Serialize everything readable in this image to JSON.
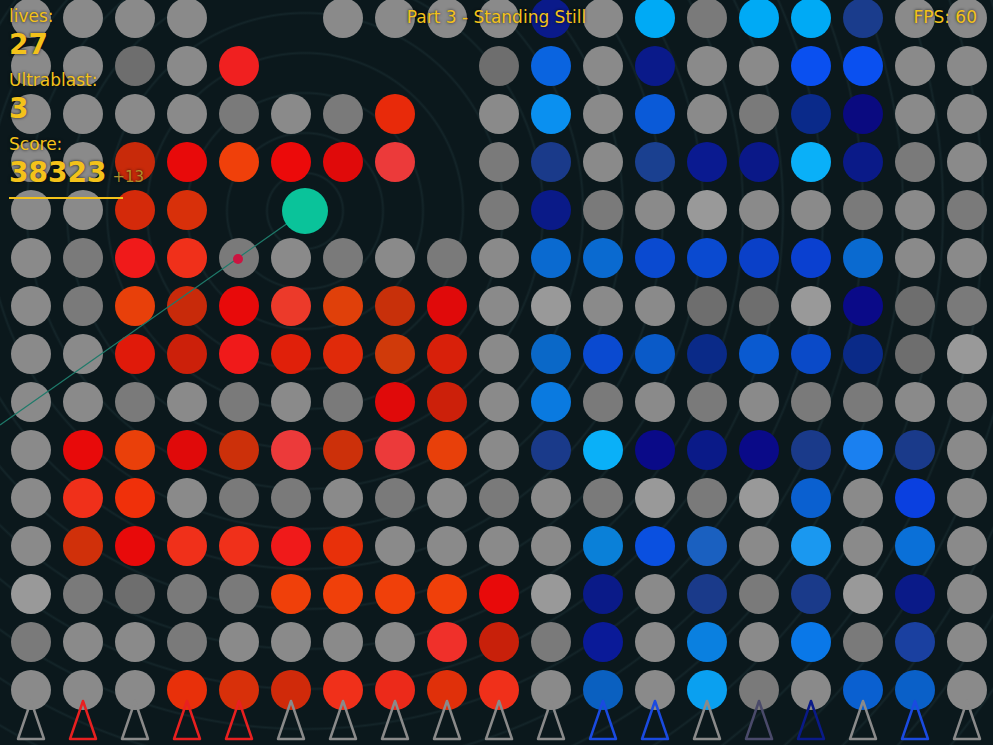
{
  "hud": {
    "lives_label": "lives:",
    "lives": "27",
    "ultrablast_label": "Ultrablast:",
    "ultrablast": "3",
    "score_label": "Score:",
    "score": "38323",
    "score_bonus": "+13"
  },
  "title": "Part 3 - Standing Still",
  "fps": "FPS: 60",
  "board": {
    "rows": [
      [
        "#8a8a8a",
        "#8a8a8a",
        "#8a8a8a",
        "#8a8a8a",
        null,
        null,
        "#8a8a8a",
        "#8a8a8a",
        "#8a8a8a",
        "#8a8a8a",
        "#0a1a8a",
        "#8a8a8a",
        "#00aaf5",
        "#7a7a7a",
        "#00aaf5",
        "#00aaf5",
        "#1a3c8c",
        "#8a8a8a",
        "#8a8a8a"
      ],
      [
        "#8a8a8a",
        "#8a8a8a",
        "#6e6e6e",
        "#8a8a8a",
        "#f02020",
        null,
        null,
        null,
        null,
        "#6e6e6e",
        "#0a64e0",
        "#8a8a8a",
        "#0a1a8a",
        "#8a8a8a",
        "#8a8a8a",
        "#0a50f0",
        "#0a50f0",
        "#8a8a8a",
        "#8a8a8a"
      ],
      [
        "#8a8a8a",
        "#8a8a8a",
        "#8a8a8a",
        "#8a8a8a",
        "#7a7a7a",
        "#8a8a8a",
        "#7a7a7a",
        "#e82a0a",
        null,
        "#8a8a8a",
        "#0a90f0",
        "#8a8a8a",
        "#0a5ad8",
        "#8a8a8a",
        "#7a7a7a",
        "#0a2a8a",
        "#0a0a80",
        "#8a8a8a",
        "#8a8a8a"
      ],
      [
        "#8a8a8a",
        "#8a8a8a",
        "#c82a0a",
        "#e80a0a",
        "#f0400a",
        "#ec0a0a",
        "#e00a0a",
        "#ec3a3a",
        null,
        "#7a7a7a",
        "#1a3a8a",
        "#8a8a8a",
        "#1a4090",
        "#0a1a90",
        "#0a1888",
        "#0ab0f8",
        "#0a1a88",
        "#7a7a7a",
        "#8a8a8a"
      ],
      [
        "#8a8a8a",
        "#8a8a8a",
        "#d42a0a",
        "#d8300a",
        null,
        null,
        null,
        null,
        null,
        "#7a7a7a",
        "#0a1a88",
        "#7a7a7a",
        "#8a8a8a",
        "#999999",
        "#8a8a8a",
        "#8a8a8a",
        "#7a7a7a",
        "#8a8a8a",
        "#7a7a7a"
      ],
      [
        "#8a8a8a",
        "#7a7a7a",
        "#f01a1a",
        "#f0301a",
        "#7a7a7a",
        "#8a8a8a",
        "#7a7a7a",
        "#8a8a8a",
        "#7a7a7a",
        "#8a8a8a",
        "#0a6ad0",
        "#0a6ad0",
        "#0a4ad0",
        "#0a4ad0",
        "#0a40c8",
        "#0a40d0",
        "#0a6ad0",
        "#8a8a8a",
        "#8a8a8a"
      ],
      [
        "#8a8a8a",
        "#7a7a7a",
        "#e8400a",
        "#c82a0a",
        "#e80a0a",
        "#ec3a2a",
        "#e0400a",
        "#c8300a",
        "#e00a0a",
        "#8a8a8a",
        "#999999",
        "#8a8a8a",
        "#8a8a8a",
        "#6e6e6e",
        "#6e6e6e",
        "#999999",
        "#0a0a88",
        "#6e6e6e",
        "#7a7a7a"
      ],
      [
        "#8a8a8a",
        "#8a8a8a",
        "#e01a0a",
        "#cc200a",
        "#f01a1a",
        "#e0200a",
        "#e02a0a",
        "#d03a0a",
        "#d8200a",
        "#8a8a8a",
        "#0a68c8",
        "#0a4ad0",
        "#0a5ac8",
        "#0a2a88",
        "#0a5ad0",
        "#0a4ac8",
        "#0a2a88",
        "#6e6e6e",
        "#999999"
      ],
      [
        "#8a8a8a",
        "#8a8a8a",
        "#7a7a7a",
        "#8a8a8a",
        "#7a7a7a",
        "#8a8a8a",
        "#7a7a7a",
        "#e00a0a",
        "#cc200a",
        "#8a8a8a",
        "#0a7ae0",
        "#7a7a7a",
        "#8a8a8a",
        "#7a7a7a",
        "#8a8a8a",
        "#7a7a7a",
        "#7a7a7a",
        "#8a8a8a",
        "#8a8a8a"
      ],
      [
        "#8a8a8a",
        "#e80a0a",
        "#ea400a",
        "#e00a0a",
        "#cc300a",
        "#ec3a3a",
        "#cc300a",
        "#ec3a3a",
        "#e8400a",
        "#8a8a8a",
        "#1a3a8a",
        "#0ab0f8",
        "#0a0a88",
        "#0a1a88",
        "#0a0a88",
        "#1a3a8a",
        "#1a80f0",
        "#1a3a8a",
        "#8a8a8a"
      ],
      [
        "#8a8a8a",
        "#f0301a",
        "#f0300a",
        "#8a8a8a",
        "#7a7a7a",
        "#7a7a7a",
        "#8a8a8a",
        "#7a7a7a",
        "#8a8a8a",
        "#7a7a7a",
        "#8a8a8a",
        "#7a7a7a",
        "#999999",
        "#7a7a7a",
        "#999999",
        "#0a60d0",
        "#8a8a8a",
        "#0a40e0",
        "#8a8a8a"
      ],
      [
        "#8a8a8a",
        "#d0300a",
        "#e80a0a",
        "#f0301a",
        "#f0301a",
        "#f01a1a",
        "#e8300a",
        "#8a8a8a",
        "#8a8a8a",
        "#8a8a8a",
        "#8a8a8a",
        "#0a80d8",
        "#0a50e0",
        "#1a60c0",
        "#8a8a8a",
        "#1a98f0",
        "#8a8a8a",
        "#0a70d8",
        "#8a8a8a"
      ],
      [
        "#999999",
        "#7a7a7a",
        "#6e6e6e",
        "#7a7a7a",
        "#7a7a7a",
        "#f0400a",
        "#f0400a",
        "#f0400a",
        "#f0400a",
        "#e80a0a",
        "#999999",
        "#0a1a88",
        "#8a8a8a",
        "#1a3a8a",
        "#7a7a7a",
        "#1a3a8a",
        "#999999",
        "#0a1a88",
        "#8a8a8a"
      ],
      [
        "#7a7a7a",
        "#8a8a8a",
        "#8a8a8a",
        "#7a7a7a",
        "#8a8a8a",
        "#8a8a8a",
        "#8a8a8a",
        "#8a8a8a",
        "#f0302a",
        "#c8200a",
        "#7a7a7a",
        "#0a1a98",
        "#8a8a8a",
        "#0a80e0",
        "#8a8a8a",
        "#0a78e8",
        "#7a7a7a",
        "#1a40a0",
        "#8a8a8a"
      ],
      [
        "#8a8a8a",
        "#8a8a8a",
        "#8a8a8a",
        "#e8300a",
        "#d8300a",
        "#d02a0a",
        "#f0301a",
        "#ec2a1a",
        "#e0300a",
        "#f0301a",
        "#8a8a8a",
        "#0a60c0",
        "#8a8a8a",
        "#0aa0f0",
        "#7a7a7a",
        "#8a8a8a",
        "#0a60d0",
        "#0a60c8",
        "#8a8a8a"
      ]
    ]
  },
  "turrets": [
    "#8a8a8a",
    "#e82020",
    "#8a8a8a",
    "#e82020",
    "#e82020",
    "#8a8a8a",
    "#8a8a8a",
    "#8a8a8a",
    "#8a8a8a",
    "#8a8a8a",
    "#8a8a8a",
    "#1a4ae0",
    "#1a4ae0",
    "#8a8a8a",
    "#4a4a6a",
    "#0a1a88",
    "#8a8a8a",
    "#1a4ae0",
    "#8a8a8a"
  ]
}
